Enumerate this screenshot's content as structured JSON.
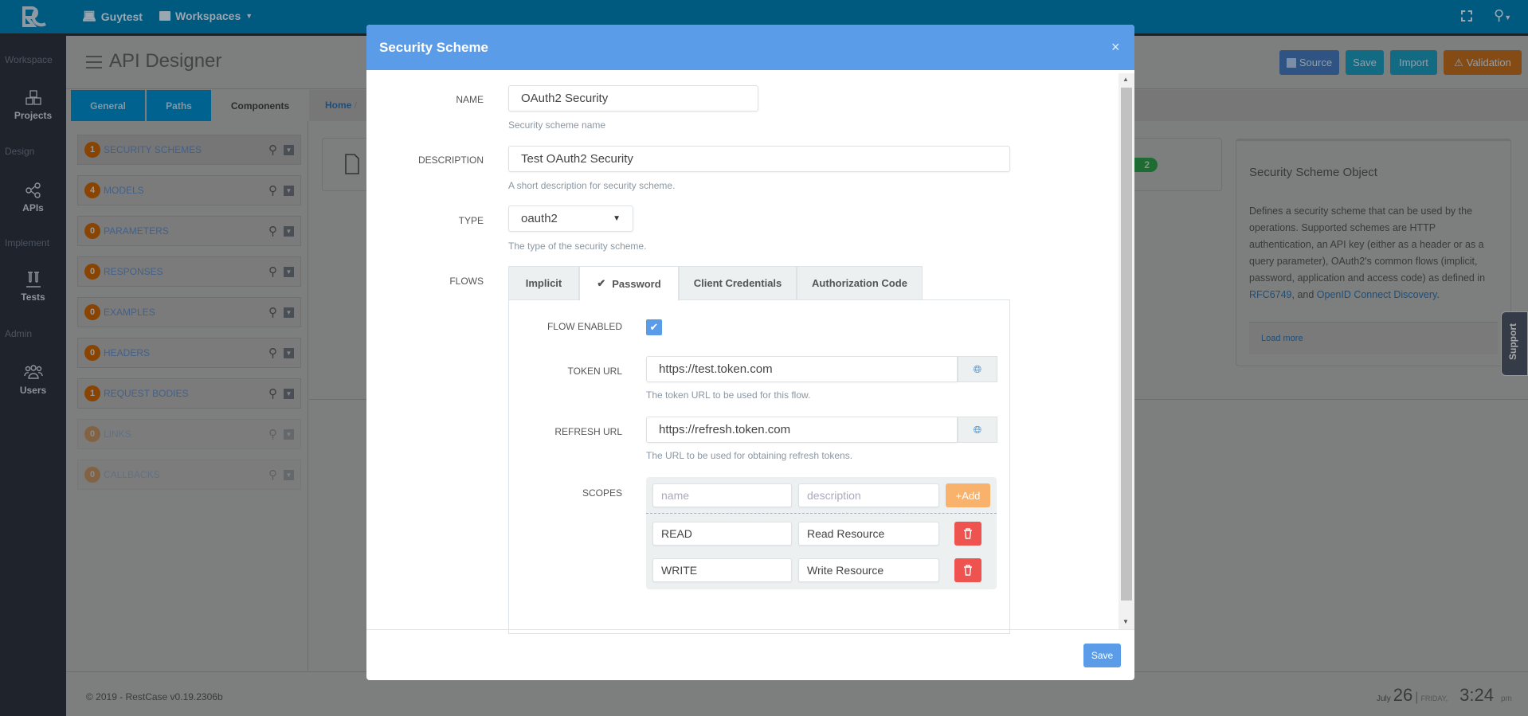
{
  "topbar": {
    "workspace_name": "Guytest",
    "workspaces_label": "Workspaces"
  },
  "sidebar": {
    "sections": [
      {
        "label": "Workspace",
        "item": "Projects"
      },
      {
        "label": "Design",
        "item": "APIs"
      },
      {
        "label": "Implement",
        "item": "Tests"
      },
      {
        "label": "Admin",
        "item": "Users"
      }
    ]
  },
  "header": {
    "title": "API Designer",
    "buttons": {
      "source": "Source",
      "save": "Save",
      "import": "Import",
      "validation": "Validation"
    }
  },
  "tabs": [
    "General",
    "Paths",
    "Components"
  ],
  "breadcrumb": {
    "home": "Home",
    "separator": "/"
  },
  "components": [
    {
      "count": "1",
      "label": "SECURITY SCHEMES"
    },
    {
      "count": "4",
      "label": "MODELS"
    },
    {
      "count": "0",
      "label": "PARAMETERS"
    },
    {
      "count": "0",
      "label": "RESPONSES"
    },
    {
      "count": "0",
      "label": "EXAMPLES"
    },
    {
      "count": "0",
      "label": "HEADERS"
    },
    {
      "count": "1",
      "label": "REQUEST BODIES"
    },
    {
      "count": "0",
      "label": "LINKS",
      "disabled": true
    },
    {
      "count": "0",
      "label": "CALLBACKS",
      "disabled": true
    }
  ],
  "card": {
    "badge": "2"
  },
  "info": {
    "title": "Security Scheme Object",
    "text": "Defines a security scheme that can be used by the operations. Supported schemes are HTTP authentication, an API key (either as a header or as a query parameter), OAuth2's common flows (implicit, password, application and access code) as defined in ",
    "link1": "RFC6749",
    "mid": ", and ",
    "link2": "OpenID Connect Discovery",
    "end": ".",
    "load_more": "Load more"
  },
  "support": "Support",
  "footer": {
    "copyright": "© 2019 - RestCase v0.19.2306b",
    "month": "July",
    "day": "26",
    "sep": "|",
    "weekday": "FRIDAY,",
    "time": "3:24",
    "ampm": "pm"
  },
  "modal": {
    "title": "Security Scheme",
    "close": "×",
    "name": {
      "label": "NAME",
      "value": "OAuth2 Security",
      "help": "Security scheme name"
    },
    "description": {
      "label": "DESCRIPTION",
      "value": "Test OAuth2 Security",
      "help": "A short description for security scheme."
    },
    "type": {
      "label": "TYPE",
      "value": "oauth2",
      "help": "The type of the security scheme."
    },
    "flows": {
      "label": "FLOWS",
      "tabs": [
        "Implicit",
        "Password",
        "Client Credentials",
        "Authorization Code"
      ],
      "active": "Password",
      "flow_enabled": {
        "label": "FLOW ENABLED",
        "checked": true
      },
      "token_url": {
        "label": "TOKEN URL",
        "value": "https://test.token.com",
        "help": "The token URL to be used for this flow."
      },
      "refresh_url": {
        "label": "REFRESH URL",
        "value": "https://refresh.token.com",
        "help": "The URL to be used for obtaining refresh tokens."
      },
      "scopes": {
        "label": "SCOPES",
        "name_placeholder": "name",
        "description_placeholder": "description",
        "add_label": "Add",
        "items": [
          {
            "name": "READ",
            "description": "Read Resource"
          },
          {
            "name": "WRITE",
            "description": "Write Resource"
          }
        ]
      }
    },
    "save": "Save"
  },
  "colors": {
    "modal_header": "#5b9ce8",
    "add": "#f9b26b",
    "delete": "#ef5350",
    "checkbox": "#5b9ce8"
  }
}
